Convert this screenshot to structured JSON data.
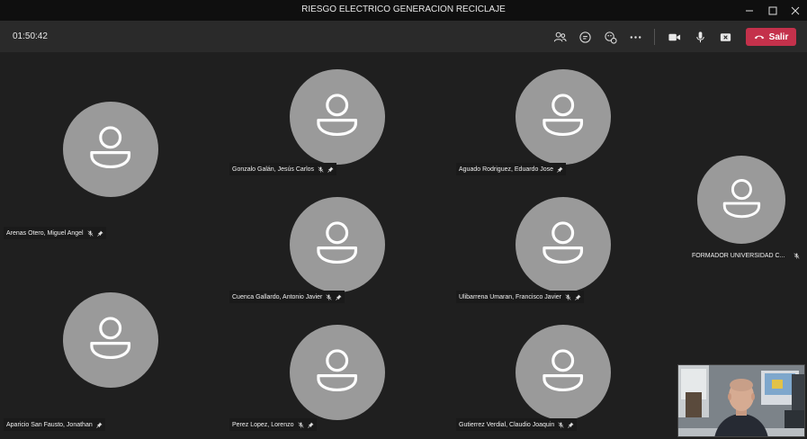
{
  "window": {
    "title": "RIESGO ELECTRICO GENERACION RECICLAJE"
  },
  "toolbar": {
    "timer": "01:50:42",
    "leave_label": "Salir",
    "icons": [
      "people-icon",
      "chat-icon",
      "reactions-icon",
      "more-icon",
      "camera-icon",
      "mic-icon",
      "share-icon",
      "phone-icon"
    ],
    "leave_color": "#c4314b"
  },
  "participants": [
    {
      "name": "Arenas Otero, Miguel Angel",
      "mic": true,
      "pin": true
    },
    {
      "name": "Gonzalo Galán, Jesús Carlos",
      "mic": true,
      "pin": true
    },
    {
      "name": "Aguado Rodriguez, Eduardo Jose",
      "mic": false,
      "pin": true
    },
    {
      "name": "FORMADOR UNIVERSIDAD C...",
      "mic": true,
      "pin": false
    },
    {
      "name": "Cuenca Gallardo, Antonio Javier",
      "mic": true,
      "pin": true
    },
    {
      "name": "Ulibarrena Umaran, Francisco Javier",
      "mic": true,
      "pin": true
    },
    {
      "name": "Aparicio San Fausto, Jonathan",
      "mic": false,
      "pin": true
    },
    {
      "name": "Perez Lopez, Lorenzo",
      "mic": true,
      "pin": true
    },
    {
      "name": "Gutierrez Verdial, Claudio Joaquin",
      "mic": true,
      "pin": true
    }
  ],
  "colors": {
    "background": "#1f1f1f",
    "avatar": "#9a9a9a",
    "titlebar": "#0f0f0f",
    "toolbar": "#2a2a2a"
  }
}
